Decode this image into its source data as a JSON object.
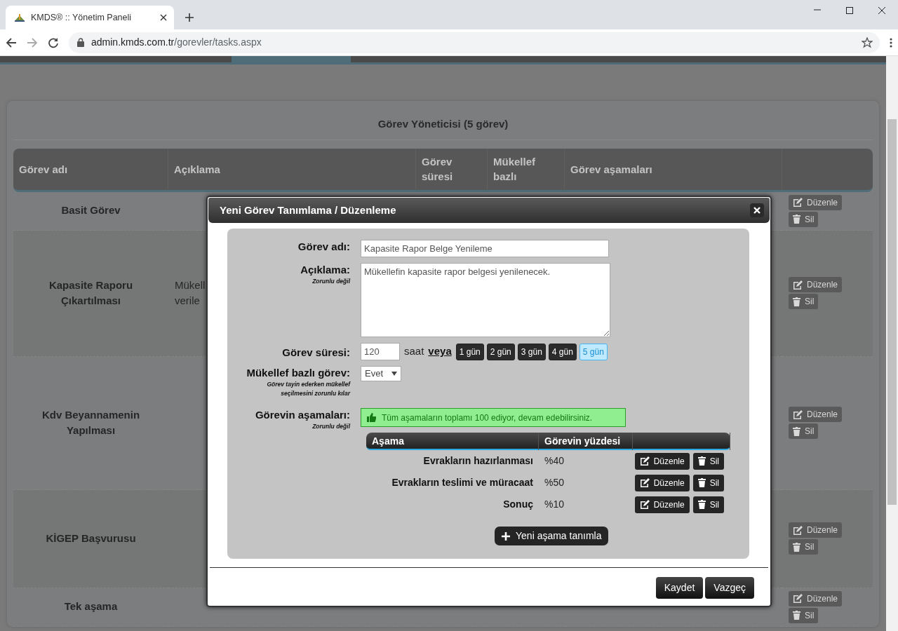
{
  "browser": {
    "tab_title": "KMDS® :: Yönetim Paneli",
    "url_host": "admin.kmds.com.tr",
    "url_path": "/gorevler/tasks.aspx"
  },
  "page": {
    "panel_title": "Görev Yöneticisi (5 görev)",
    "columns": [
      "Görev adı",
      "Açıklama",
      "Görev süresi",
      "Mükellef bazlı",
      "Görev aşamaları"
    ],
    "rows": [
      {
        "name": "Basit Görev",
        "actions": [
          "Düzenle",
          "Sil"
        ]
      },
      {
        "name": "Kapasite Raporu Çıkartılması",
        "description": "Mükell verile",
        "actions": [
          "Düzenle",
          "Sil"
        ]
      },
      {
        "name": "Kdv Beyannamenin Yapılması",
        "actions": [
          "Düzenle",
          "Sil"
        ]
      },
      {
        "name": "KİGEP Başvurusu",
        "actions": [
          "Düzenle",
          "Sil"
        ]
      },
      {
        "name": "Tek aşama",
        "actions": [
          "Düzenle",
          "Sil"
        ]
      }
    ]
  },
  "modal": {
    "title": "Yeni Görev Tanımlama / Düzenleme",
    "name_field": {
      "label": "Görev adı:",
      "value": "Kapasite Rapor Belge Yenileme"
    },
    "description_field": {
      "label": "Açıklama:",
      "note": "Zorunlu değil",
      "value": "Mükellefin kapasite rapor belgesi yenilenecek."
    },
    "duration": {
      "label": "Görev süresi:",
      "value": "120",
      "unit": "saat",
      "or": "veya",
      "options": [
        {
          "label": "1 gün",
          "selected": false
        },
        {
          "label": "2 gün",
          "selected": false
        },
        {
          "label": "3 gün",
          "selected": false
        },
        {
          "label": "4 gün",
          "selected": false
        },
        {
          "label": "5 gün",
          "selected": true
        }
      ]
    },
    "taxpayer_based": {
      "label": "Mükellef bazlı görev:",
      "note": "Görev tayin ederken mükellef seçilmesini zorunlu kılar",
      "value": "Evet"
    },
    "stages": {
      "label": "Görevin aşamaları:",
      "note": "Zorunlu değil",
      "alert": "Tüm aşamaların toplamı 100 ediyor, devam edebilirsiniz.",
      "columns": [
        "Aşama",
        "Görevin yüzdesi"
      ],
      "rows": [
        {
          "name": "Evrakların hazırlanması",
          "percent": "%40",
          "actions": [
            "Düzenle",
            "Sil"
          ]
        },
        {
          "name": "Evrakların teslimi ve müracaat",
          "percent": "%50",
          "actions": [
            "Düzenle",
            "Sil"
          ]
        },
        {
          "name": "Sonuç",
          "percent": "%10",
          "actions": [
            "Düzenle",
            "Sil"
          ]
        }
      ],
      "add_button": "Yeni aşama tanımla"
    },
    "footer_buttons": [
      "Kaydet",
      "Vazgeç"
    ]
  }
}
